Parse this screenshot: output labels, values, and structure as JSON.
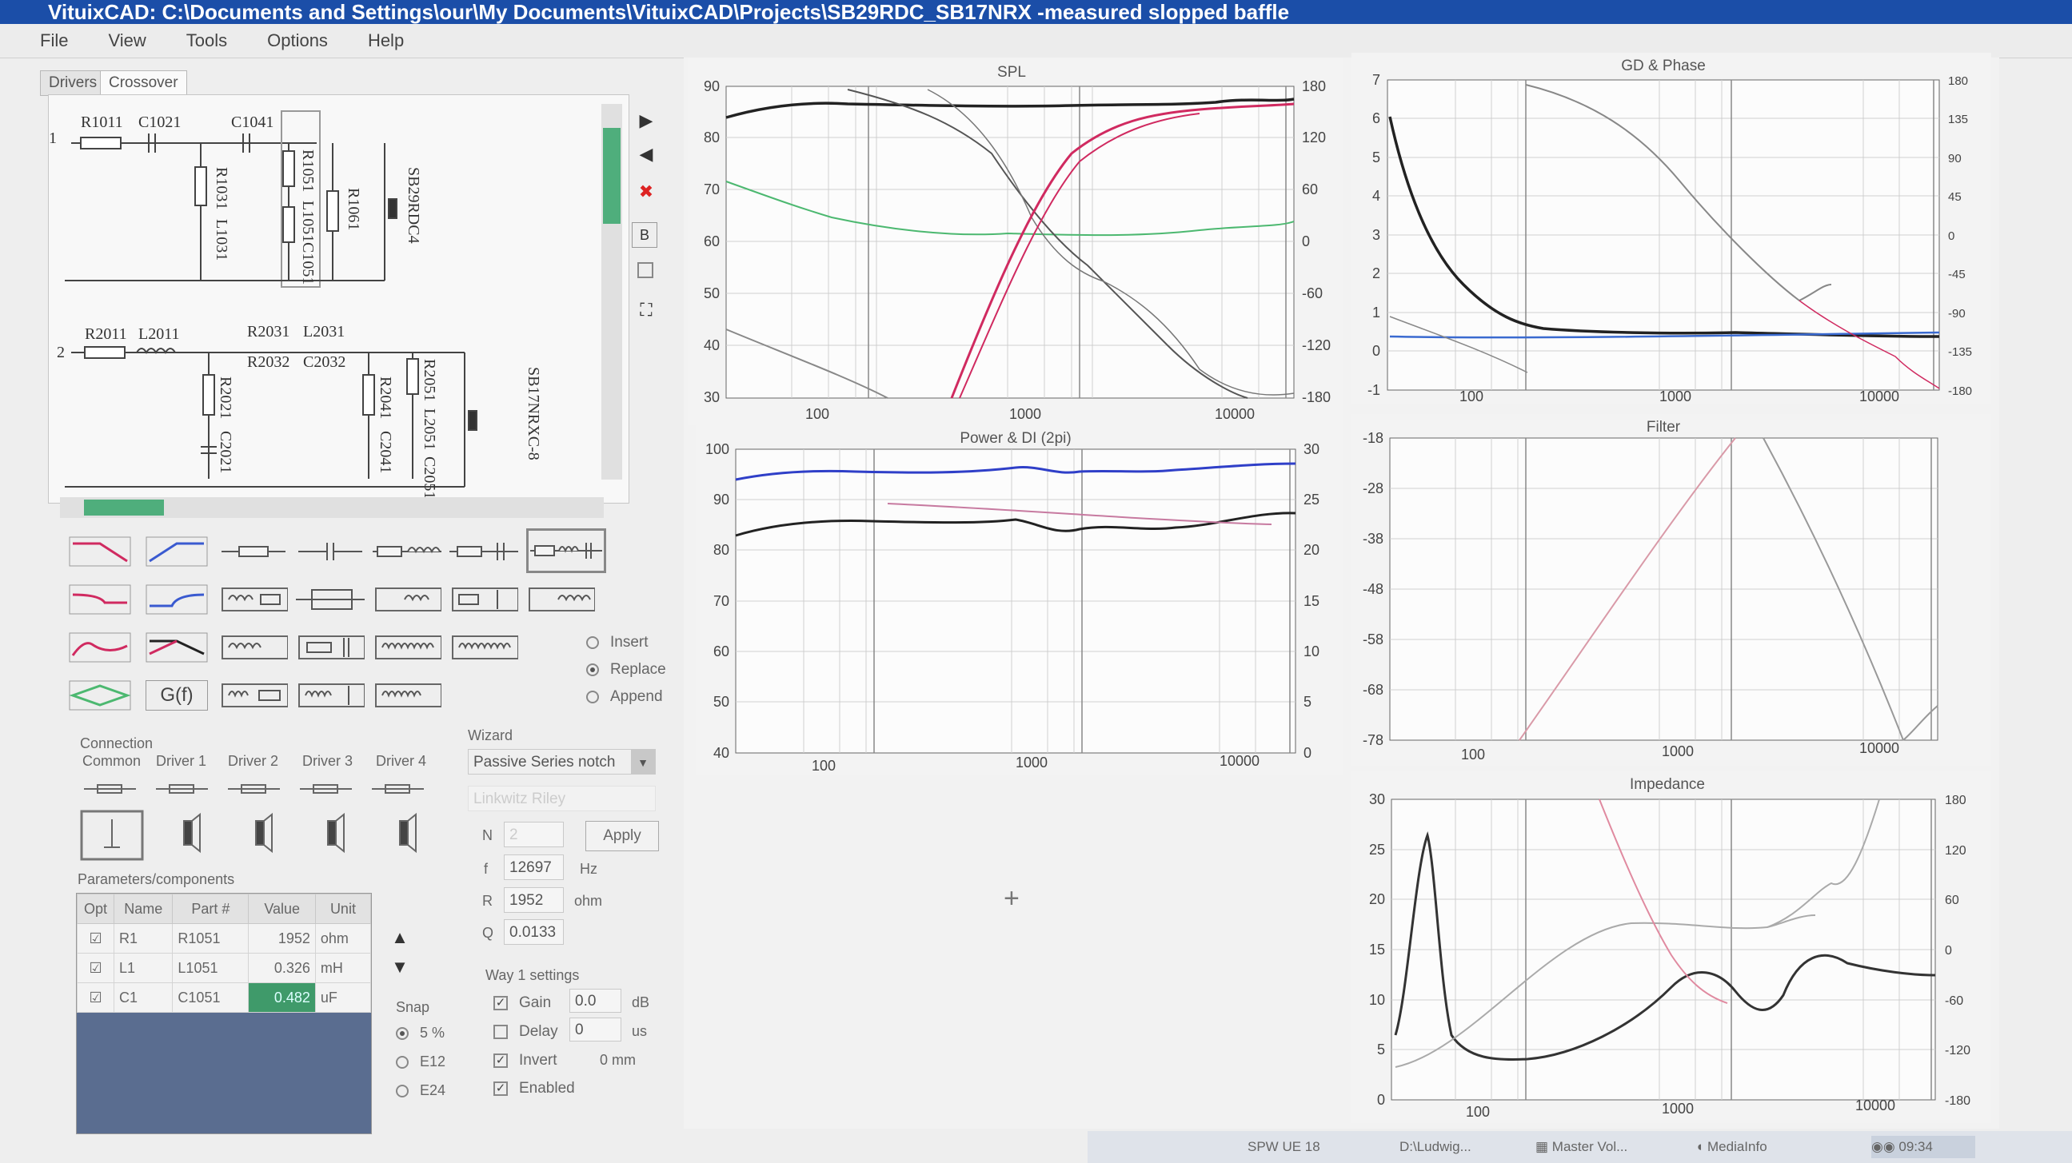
{
  "window": {
    "title": "VituixCAD: C:\\Documents and Settings\\our\\My Documents\\VituixCAD\\Projects\\SB29RDC_SB17NRX -measured slopped baffle"
  },
  "menu": [
    "File",
    "View",
    "Tools",
    "Options",
    "Help"
  ],
  "tabs": {
    "drivers": "Drivers",
    "crossover": "Crossover"
  },
  "schematic": {
    "way1": {
      "node": "1",
      "parts": [
        "R1011",
        "C1021",
        "C1041",
        "R1031",
        "L1031",
        "R1051",
        "L1051",
        "C1051",
        "R1061"
      ],
      "driver": "SB29RDC4"
    },
    "way2": {
      "node": "2",
      "parts": [
        "R2011",
        "L2011",
        "R2031",
        "L2031",
        "R2032",
        "C2032",
        "R2021",
        "C2021",
        "R2041",
        "C2041",
        "R2051",
        "L2051",
        "C2051"
      ],
      "driver": "SB17NRXC-8"
    }
  },
  "side_buttons": {
    "b": "B"
  },
  "palette": {
    "gf": "G(f)"
  },
  "mode": {
    "insert": "Insert",
    "replace": "Replace",
    "append": "Append",
    "selected": "Replace"
  },
  "connection": {
    "title": "Connection",
    "columns": [
      "Common",
      "Driver 1",
      "Driver 2",
      "Driver 3",
      "Driver 4"
    ]
  },
  "wizard": {
    "title": "Wizard",
    "type": "Passive Series notch",
    "subtype": "Linkwitz Riley",
    "n_label": "N",
    "n_value": "2",
    "apply": "Apply",
    "f_label": "f",
    "f_value": "12697",
    "f_unit": "Hz",
    "r_label": "R",
    "r_value": "1952",
    "r_unit": "ohm",
    "q_label": "Q",
    "q_value": "0.0133"
  },
  "params": {
    "title": "Parameters/components",
    "headers": [
      "Opt",
      "Name",
      "Part #",
      "Value",
      "Unit"
    ],
    "rows": [
      {
        "name": "R1",
        "part": "R1051",
        "value": "1952",
        "unit": "ohm"
      },
      {
        "name": "L1",
        "part": "L1051",
        "value": "0.326",
        "unit": "mH"
      },
      {
        "name": "C1",
        "part": "C1051",
        "value": "0.482",
        "unit": "uF"
      }
    ]
  },
  "snap": {
    "title": "Snap",
    "options": [
      "5 %",
      "E12",
      "E24"
    ],
    "selected": "5 %"
  },
  "way_settings": {
    "title": "Way 1 settings",
    "gain_label": "Gain",
    "gain_value": "0.0",
    "gain_unit": "dB",
    "delay_label": "Delay",
    "delay_value": "0",
    "delay_unit": "us",
    "invert_label": "Invert",
    "invert_value": "0 mm",
    "enabled_label": "Enabled"
  },
  "charts": {
    "spl": {
      "title": "SPL",
      "y_left": [
        "90",
        "80",
        "70",
        "60",
        "50",
        "40",
        "30"
      ],
      "y_right": [
        "180",
        "120",
        "60",
        "0",
        "-60",
        "-120",
        "-180"
      ],
      "x": [
        "100",
        "1000",
        "10000"
      ]
    },
    "gd": {
      "title": "GD & Phase",
      "y_left": [
        "7",
        "6",
        "5",
        "4",
        "3",
        "2",
        "1",
        "0",
        "-1"
      ],
      "y_right": [
        "180",
        "135",
        "90",
        "45",
        "0",
        "-45",
        "-90",
        "-135",
        "-180"
      ],
      "x": [
        "100",
        "1000",
        "10000"
      ]
    },
    "power": {
      "title": "Power & DI (2pi)",
      "y_left": [
        "100",
        "90",
        "80",
        "70",
        "60",
        "50",
        "40"
      ],
      "y_right": [
        "30",
        "25",
        "20",
        "15",
        "10",
        "5",
        "0"
      ],
      "x": [
        "100",
        "1000",
        "10000"
      ]
    },
    "filter": {
      "title": "Filter",
      "y_left": [
        "-18",
        "-28",
        "-38",
        "-48",
        "-58",
        "-68",
        "-78"
      ],
      "x": [
        "100",
        "1000",
        "10000"
      ]
    },
    "impedance": {
      "title": "Impedance",
      "y_left": [
        "30",
        "25",
        "20",
        "15",
        "10",
        "5",
        "0"
      ],
      "y_right": [
        "180",
        "120",
        "60",
        "0",
        "-60",
        "-120",
        "-180"
      ],
      "x": [
        "100",
        "1000",
        "10000"
      ]
    }
  },
  "taskbar": {
    "items": [
      "SPW UE 18",
      "D:\\Ludwig...",
      "Master Vol...",
      "MediaInfo"
    ],
    "clock": "09:34"
  },
  "colors": {
    "spl_black": "#222222",
    "pink": "#d02a60",
    "green": "#4cb870",
    "blue": "#2f3fc8",
    "grey": "#8a8a8a"
  }
}
